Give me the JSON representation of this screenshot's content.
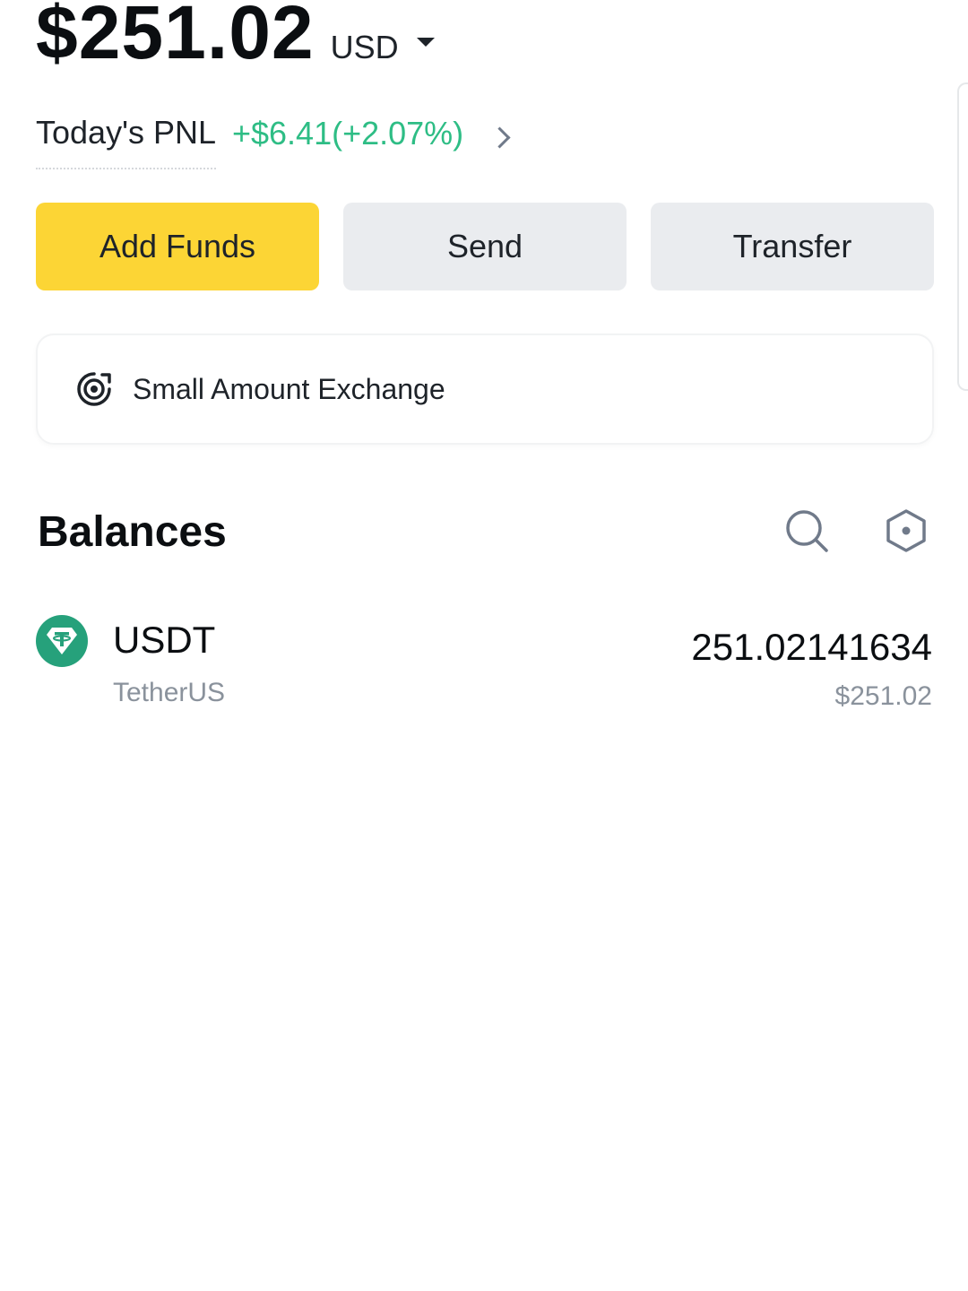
{
  "header": {
    "total_balance": "$251.02",
    "currency": "USD"
  },
  "pnl": {
    "label": "Today's PNL",
    "value": "+$6.41(+2.07%)"
  },
  "actions": {
    "add_funds": "Add Funds",
    "send": "Send",
    "transfer": "Transfer"
  },
  "exchange": {
    "label": "Small Amount Exchange"
  },
  "balances": {
    "title": "Balances",
    "items": [
      {
        "symbol": "USDT",
        "name": "TetherUS",
        "amount": "251.02141634",
        "fiat_value": "$251.02"
      }
    ]
  },
  "colors": {
    "primary_button": "#fcd535",
    "secondary_button": "#eaecef",
    "positive": "#2ebd85",
    "tether_teal": "#26a17b"
  },
  "icons": {
    "currency_caret": "caret-down-icon",
    "pnl_chevron": "chevron-right-icon",
    "exchange": "target-exchange-icon",
    "search": "search-icon",
    "hide_small": "hexagon-settings-icon",
    "coin": "tether-icon"
  }
}
